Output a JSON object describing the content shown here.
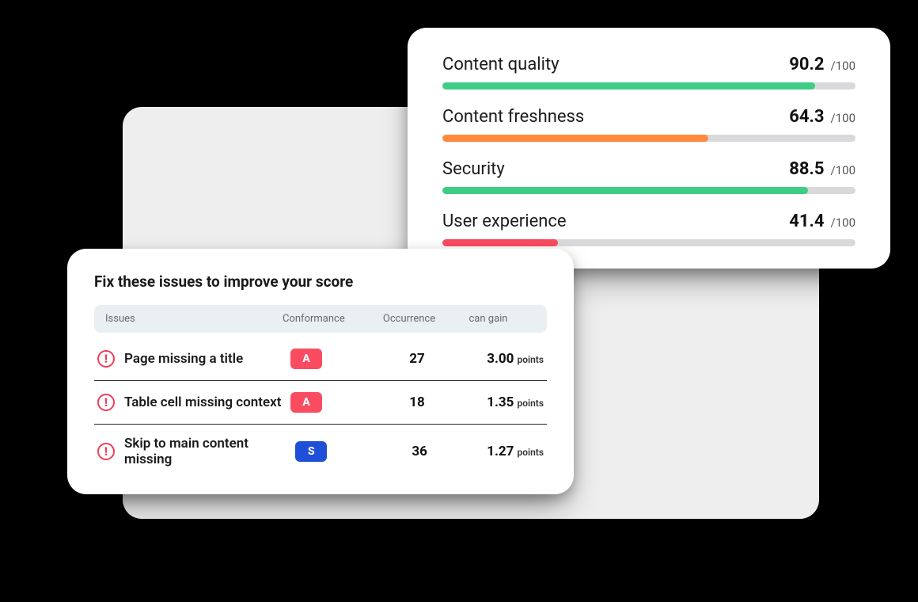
{
  "metrics": {
    "max_label": "/100",
    "items": [
      {
        "label": "Content quality",
        "value": "90.2",
        "pct": 90.2,
        "color": "green"
      },
      {
        "label": "Content freshness",
        "value": "64.3",
        "pct": 64.3,
        "color": "orange"
      },
      {
        "label": "Security",
        "value": "88.5",
        "pct": 88.5,
        "color": "green"
      },
      {
        "label": "User experience",
        "value": "41.4",
        "pct": 28.0,
        "color": "red"
      }
    ]
  },
  "issues": {
    "title": "Fix these issues to improve your score",
    "columns": {
      "issue": "Issues",
      "conformance": "Conformance",
      "occurrence": "Occurrence",
      "gain": "can gain"
    },
    "gain_unit": "points",
    "rows": [
      {
        "name": "Page missing a title",
        "badge": "A",
        "badge_style": "a",
        "occurrence": "27",
        "gain": "3.00"
      },
      {
        "name": "Table cell missing context",
        "badge": "A",
        "badge_style": "a",
        "occurrence": "18",
        "gain": "1.35"
      },
      {
        "name": "Skip to main content missing",
        "badge": "S",
        "badge_style": "s",
        "occurrence": "36",
        "gain": "1.27"
      }
    ]
  },
  "chart_data": {
    "type": "bar",
    "title": "",
    "categories": [
      "Content quality",
      "Content freshness",
      "Security",
      "User experience"
    ],
    "values": [
      90.2,
      64.3,
      88.5,
      41.4
    ],
    "ylim": [
      0,
      100
    ],
    "xlabel": "",
    "ylabel": "/100"
  }
}
